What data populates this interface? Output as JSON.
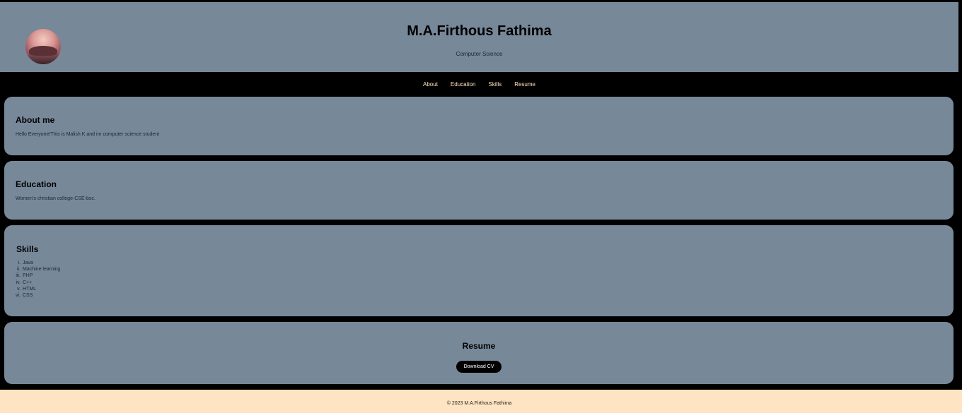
{
  "header": {
    "title": "M.A.Firthous Fathima",
    "subtitle": "Computer Science"
  },
  "nav": {
    "items": [
      "About",
      "Education",
      "Skills",
      "Resume"
    ]
  },
  "about": {
    "heading": "About me",
    "text": "Hello Everyone!This is Malish K and im computer science student"
  },
  "education": {
    "heading": "Education",
    "text": "Women's christian college-CSE-bsc."
  },
  "skills": {
    "heading": "Skills",
    "items": [
      {
        "num": "i.",
        "label": "Java"
      },
      {
        "num": "ii.",
        "label": "Machine learning"
      },
      {
        "num": "iii.",
        "label": "PHP"
      },
      {
        "num": "iv.",
        "label": "C++"
      },
      {
        "num": "v.",
        "label": "HTML"
      },
      {
        "num": "vi.",
        "label": "CSS"
      }
    ]
  },
  "resume": {
    "heading": "Resume",
    "button_label": "Download CV"
  },
  "footer": {
    "text": "© 2023 M.A.Firthous Fathima"
  },
  "colors": {
    "panel": "#778899",
    "background": "#000000",
    "nav_link": "#ffe4b5",
    "footer": "#ffe4c4"
  }
}
